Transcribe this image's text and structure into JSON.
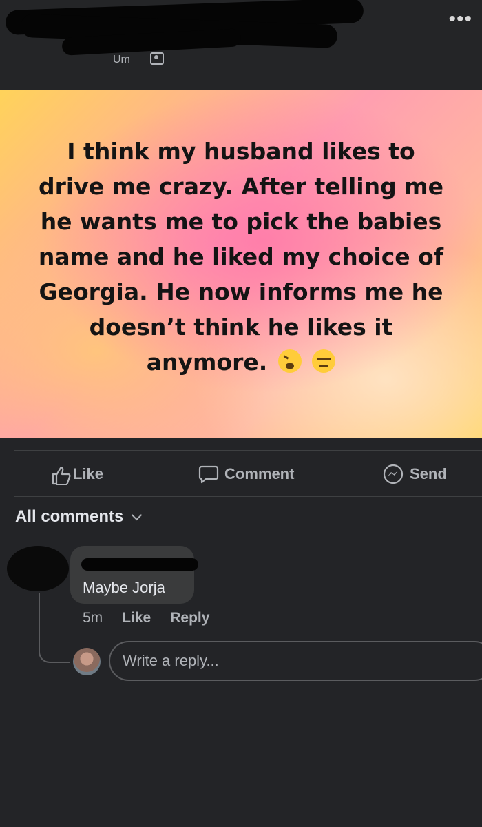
{
  "header": {
    "more_label": "•••",
    "meta_stub": "Um",
    "audience_icon": "friends-icon"
  },
  "post": {
    "text": "I think my husband likes to drive me crazy. After telling me he wants me to pick the babies name and he liked my choice of Georgia. He now informs me he doesn’t think he likes it anymore.",
    "emojis": [
      "tired-face-emoji",
      "unamused-face-emoji"
    ],
    "background_colors": [
      "#ffd35a",
      "#ff9fb0",
      "#ffd45a"
    ]
  },
  "actions": {
    "like": "Like",
    "comment": "Comment",
    "send": "Send"
  },
  "comments": {
    "filter_label": "All comments",
    "items": [
      {
        "text": "Maybe Jorja",
        "time": "5m",
        "like_label": "Like",
        "reply_label": "Reply"
      }
    ],
    "reply_placeholder": "Write a reply..."
  },
  "colors": {
    "background": "#232427",
    "bubble": "#3a3b3c",
    "secondary_text": "#b0b3b8"
  }
}
